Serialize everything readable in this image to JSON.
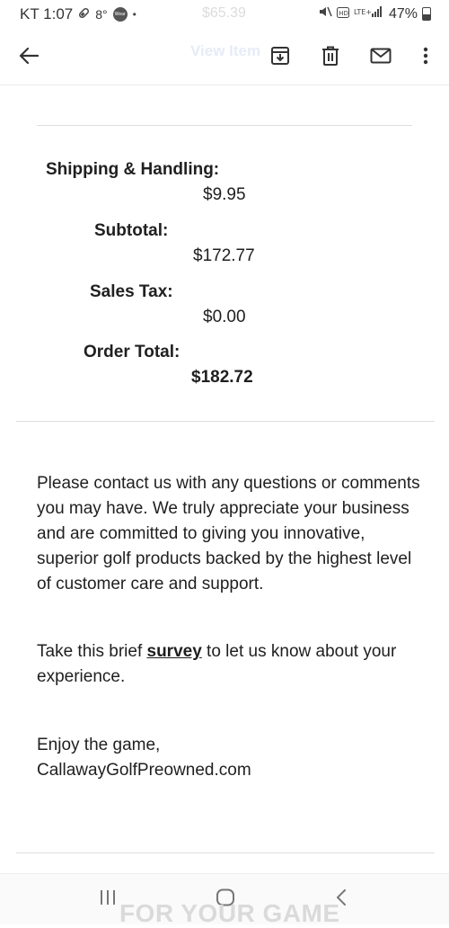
{
  "status_bar": {
    "carrier_time": "KT 1:07",
    "temperature": "8°",
    "wear_badge": "Wear",
    "dot": "•",
    "ghost_price": "$65.39",
    "right_text": "47%"
  },
  "app_bar": {
    "ghost_link": "View Item"
  },
  "totals": {
    "shipping_label": "Shipping & Handling:",
    "shipping_value": "$9.95",
    "subtotal_label": "Subtotal:",
    "subtotal_value": "$172.77",
    "tax_label": "Sales Tax:",
    "tax_value": "$0.00",
    "order_total_label": "Order Total:",
    "order_total_value": "$182.72"
  },
  "message": {
    "contact_text": "Please contact us with any questions or comments you may have. We truly appreciate your business and are committed to giving you innovative, superior golf products backed by the highest level of customer care and support.",
    "survey_prefix": "Take this brief ",
    "survey_link": "survey",
    "survey_suffix": " to let us know about your experience.",
    "closing": "Enjoy the game,",
    "signature": "CallawayGolfPreowned.com"
  },
  "footer": {
    "ghost_text": "FOR YOUR GAME"
  },
  "icons": {
    "back": "arrow-left",
    "archive": "archive-box",
    "delete": "trash",
    "mail": "envelope",
    "more": "vertical-dots",
    "nav_recents": "three-bars",
    "nav_home": "rounded-square",
    "nav_back": "chevron-left"
  }
}
